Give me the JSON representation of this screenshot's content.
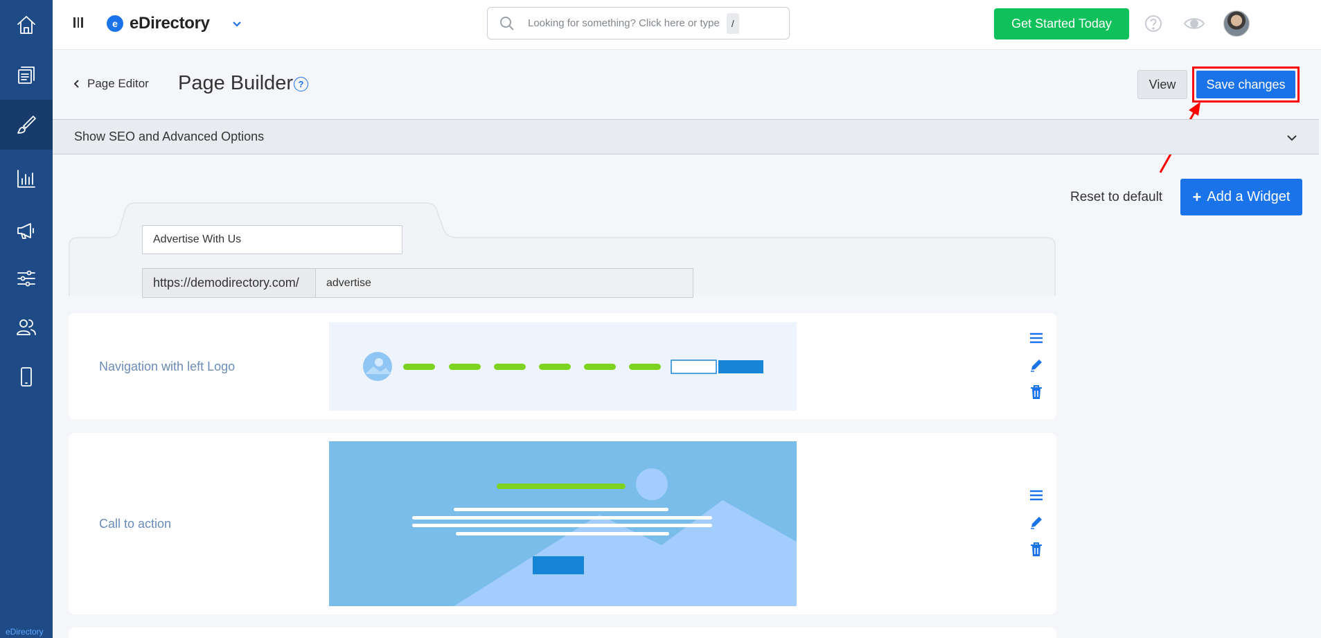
{
  "app": {
    "name": "eDirectory",
    "footer": "eDirectory"
  },
  "sidebar": {
    "items": [
      {
        "icon": "home-icon"
      },
      {
        "icon": "pages-icon"
      },
      {
        "icon": "brush-icon",
        "active": true
      },
      {
        "icon": "reports-icon"
      },
      {
        "icon": "megaphone-icon"
      },
      {
        "icon": "settings-sliders-icon"
      },
      {
        "icon": "users-icon"
      },
      {
        "icon": "mobile-icon"
      }
    ]
  },
  "header": {
    "search_placeholder": "Looking for something? Click here or type",
    "search_shortcut": "/",
    "cta_label": "Get Started Today"
  },
  "page": {
    "back_label": "Page Editor",
    "title": "Page Builder",
    "help_glyph": "?",
    "view_label": "View",
    "save_label": "Save changes",
    "seo_label": "Show SEO and Advanced Options",
    "reset_label": "Reset to default",
    "add_widget_label": "Add a Widget",
    "add_widget_icon": "+"
  },
  "page_settings": {
    "name_value": "Advertise With Us",
    "url_prefix": "https://demodirectory.com/",
    "url_slug": "advertise"
  },
  "widgets": [
    {
      "label": "Navigation with left Logo",
      "preview": "navigation-left-logo"
    },
    {
      "label": "Call to action",
      "preview": "call-to-action"
    }
  ],
  "colors": {
    "sidebar": "#1e4b86",
    "primary": "#1a73e8",
    "success": "#10c05a",
    "annotation": "#ff0000"
  }
}
